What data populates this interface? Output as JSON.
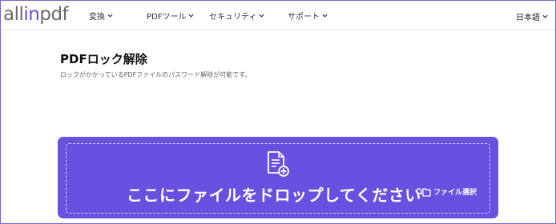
{
  "header": {
    "logo": {
      "part1": "all",
      "part2": "in",
      "part3": "pdf"
    },
    "nav": [
      {
        "label": "変換"
      },
      {
        "label": "PDFツール"
      },
      {
        "label": "セキュリティ"
      },
      {
        "label": "サポート"
      }
    ],
    "language": "日本語"
  },
  "main": {
    "title": "PDFロック解除",
    "subtitle": "ロックがかかっているPDFファイルのパスワード解除が可能です。"
  },
  "dropzone": {
    "text": "ここにファイルをドロップしてください",
    "select_label": "ファイル選択"
  },
  "colors": {
    "accent": "#6a50e1",
    "logo_accent": "#6c4fe0"
  }
}
